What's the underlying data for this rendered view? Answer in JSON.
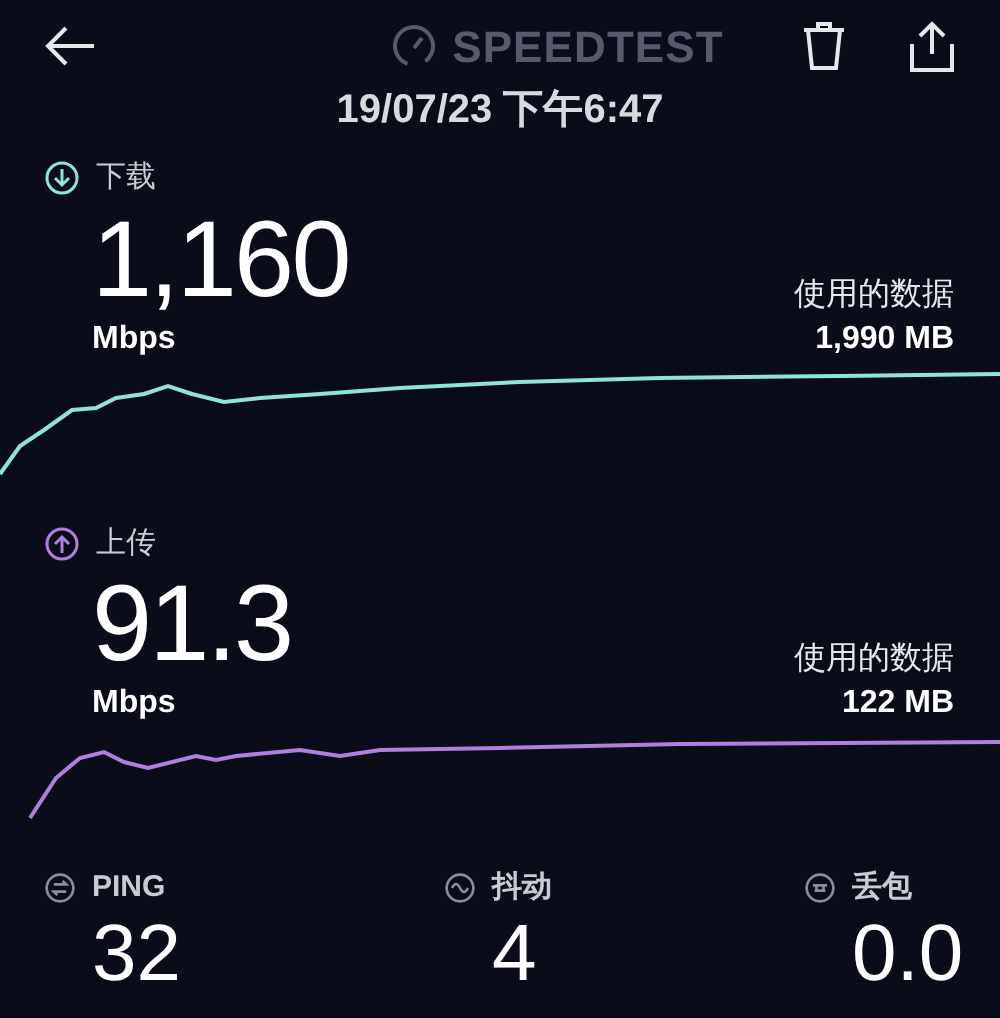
{
  "header": {
    "title": "SPEEDTEST",
    "datetime": "19/07/23 下午6:47"
  },
  "results": [
    {
      "kind": "download",
      "label": "下载",
      "value": "1,160",
      "unit": "Mbps",
      "data_label": "使用的数据",
      "data_value": "1,990 MB",
      "color": "#8ee3dc"
    },
    {
      "kind": "upload",
      "label": "上传",
      "value": "91.3",
      "unit": "Mbps",
      "data_label": "使用的数据",
      "data_value": "122 MB",
      "color": "#b07fe0"
    }
  ],
  "metrics": [
    {
      "kind": "ping",
      "label": "PING",
      "value": "32"
    },
    {
      "kind": "jitter",
      "label": "抖动",
      "value": "4"
    },
    {
      "kind": "loss",
      "label": "丢包",
      "value": "0.0"
    }
  ]
}
